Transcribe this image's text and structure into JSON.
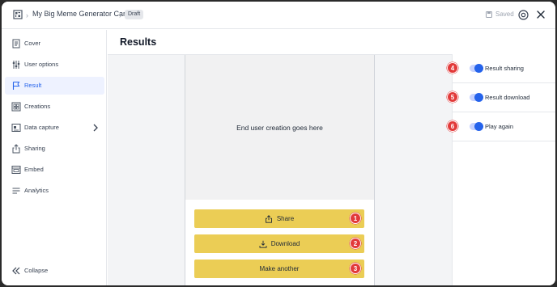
{
  "header": {
    "title": "My Big Meme Generator Card",
    "badge": "Draft",
    "saved_label": "Saved",
    "logo_icon": "grid-logo-icon",
    "help_icon": "help-circle-icon",
    "close_icon": "close-icon"
  },
  "sidebar": {
    "items": [
      {
        "label": "Cover",
        "icon": "document-icon"
      },
      {
        "label": "User options",
        "icon": "sliders-icon"
      },
      {
        "label": "Result",
        "icon": "flag-icon",
        "active": true
      },
      {
        "label": "Creations",
        "icon": "gallery-icon"
      },
      {
        "label": "Data capture",
        "icon": "form-icon",
        "has_arrow": true
      },
      {
        "label": "Sharing",
        "icon": "share-icon"
      },
      {
        "label": "Embed",
        "icon": "embed-icon"
      },
      {
        "label": "Analytics",
        "icon": "list-icon"
      }
    ],
    "collapse_label": "Collapse"
  },
  "main": {
    "title": "Results",
    "creation_placeholder": "End user creation goes here",
    "buttons": [
      {
        "label": "Share",
        "marker": "1",
        "icon": "share-icon"
      },
      {
        "label": "Download",
        "marker": "2",
        "icon": "download-icon"
      },
      {
        "label": "Make another",
        "marker": "3"
      }
    ]
  },
  "settings": {
    "toggles": [
      {
        "label": "Result sharing",
        "marker": "4",
        "enabled": true
      },
      {
        "label": "Result download",
        "marker": "5",
        "enabled": true
      },
      {
        "label": "Play again",
        "marker": "6",
        "enabled": true
      }
    ]
  },
  "colors": {
    "accent": "#2563eb",
    "button": "#ebcd55",
    "marker": "#e23a3a"
  }
}
